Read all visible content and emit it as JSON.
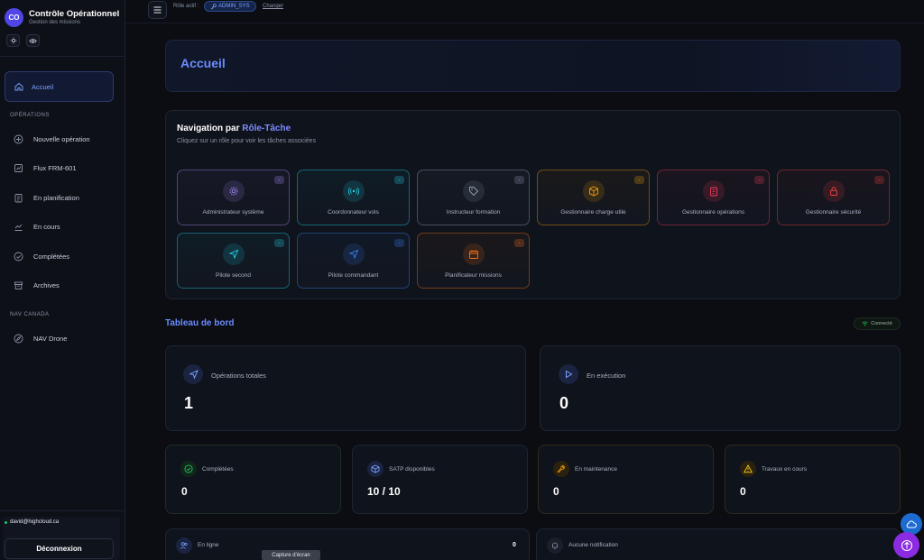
{
  "brand": {
    "logo": "CO",
    "title": "Contrôle Opérationnel",
    "subtitle": "Gestion des missions"
  },
  "sidebar": {
    "active": {
      "label": "Accueil",
      "icon": "home-icon"
    },
    "section_ops": "OPÉRATIONS",
    "ops_items": [
      {
        "label": "Nouvelle opération",
        "icon": "plus-circle-icon"
      },
      {
        "label": "Flux FRM-601",
        "icon": "flow-icon"
      },
      {
        "label": "En planification",
        "icon": "clipboard-icon"
      },
      {
        "label": "En cours",
        "icon": "chart-icon"
      },
      {
        "label": "Complétées",
        "icon": "check-circle-icon"
      },
      {
        "label": "Archives",
        "icon": "archive-icon"
      }
    ],
    "section_nav": "NAV CANADA",
    "nav_items": [
      {
        "label": "NAV Drone",
        "icon": "compass-icon"
      }
    ],
    "user_email": "david@highcloud.ca",
    "logout": "Déconnexion"
  },
  "topbar": {
    "role_label": "Rôle actif :",
    "role_value": "ADMIN_SYS",
    "change": "Changer"
  },
  "hero": {
    "title": "Accueil"
  },
  "role_nav": {
    "title_prefix": "Navigation par ",
    "title_highlight": "Rôle-Tâche",
    "subtitle": "Cliquez sur un rôle pour voir les tâches associées",
    "roles": [
      {
        "name": "Administrateur système",
        "count": "-",
        "color": "#a78bfa",
        "icon": "gear-icon"
      },
      {
        "name": "Coordonnateur vols",
        "count": "-",
        "color": "#22d3ee",
        "icon": "radio-icon"
      },
      {
        "name": "Instructeur formation",
        "count": "-",
        "color": "#94a3b8",
        "icon": "tag-icon"
      },
      {
        "name": "Gestionnaire charge utile",
        "count": "-",
        "color": "#f59e0b",
        "icon": "package-icon"
      },
      {
        "name": "Gestionnaire opérations",
        "count": "-",
        "color": "#f43f5e",
        "icon": "clipboard-icon"
      },
      {
        "name": "Gestionnaire sécurité",
        "count": "-",
        "color": "#ef4444",
        "icon": "lock-icon"
      },
      {
        "name": "Pilote second",
        "count": "-",
        "color": "#22d3ee",
        "icon": "plane-icon"
      },
      {
        "name": "Pilote commandant",
        "count": "-",
        "color": "#3b82f6",
        "icon": "plane-icon"
      },
      {
        "name": "Planificateur missions",
        "count": "-",
        "color": "#f97316",
        "icon": "calendar-icon"
      }
    ]
  },
  "dashboard": {
    "title": "Tableau de bord",
    "status": "Connecté",
    "total_ops": {
      "label": "Opérations totales",
      "value": "1"
    },
    "running": {
      "label": "En exécution",
      "value": "0"
    },
    "completed": {
      "label": "Complétées",
      "value": "0"
    },
    "satp": {
      "label": "SATP disponibles",
      "value": "10 / 10"
    },
    "maintenance": {
      "label": "En maintenance",
      "value": "0"
    },
    "works": {
      "label": "Travaux en cours",
      "value": "0"
    },
    "online": {
      "label": "En ligne",
      "value": "0"
    },
    "notifications": {
      "label": "Aucune notification"
    }
  },
  "tooltip": "Capture d'écran"
}
